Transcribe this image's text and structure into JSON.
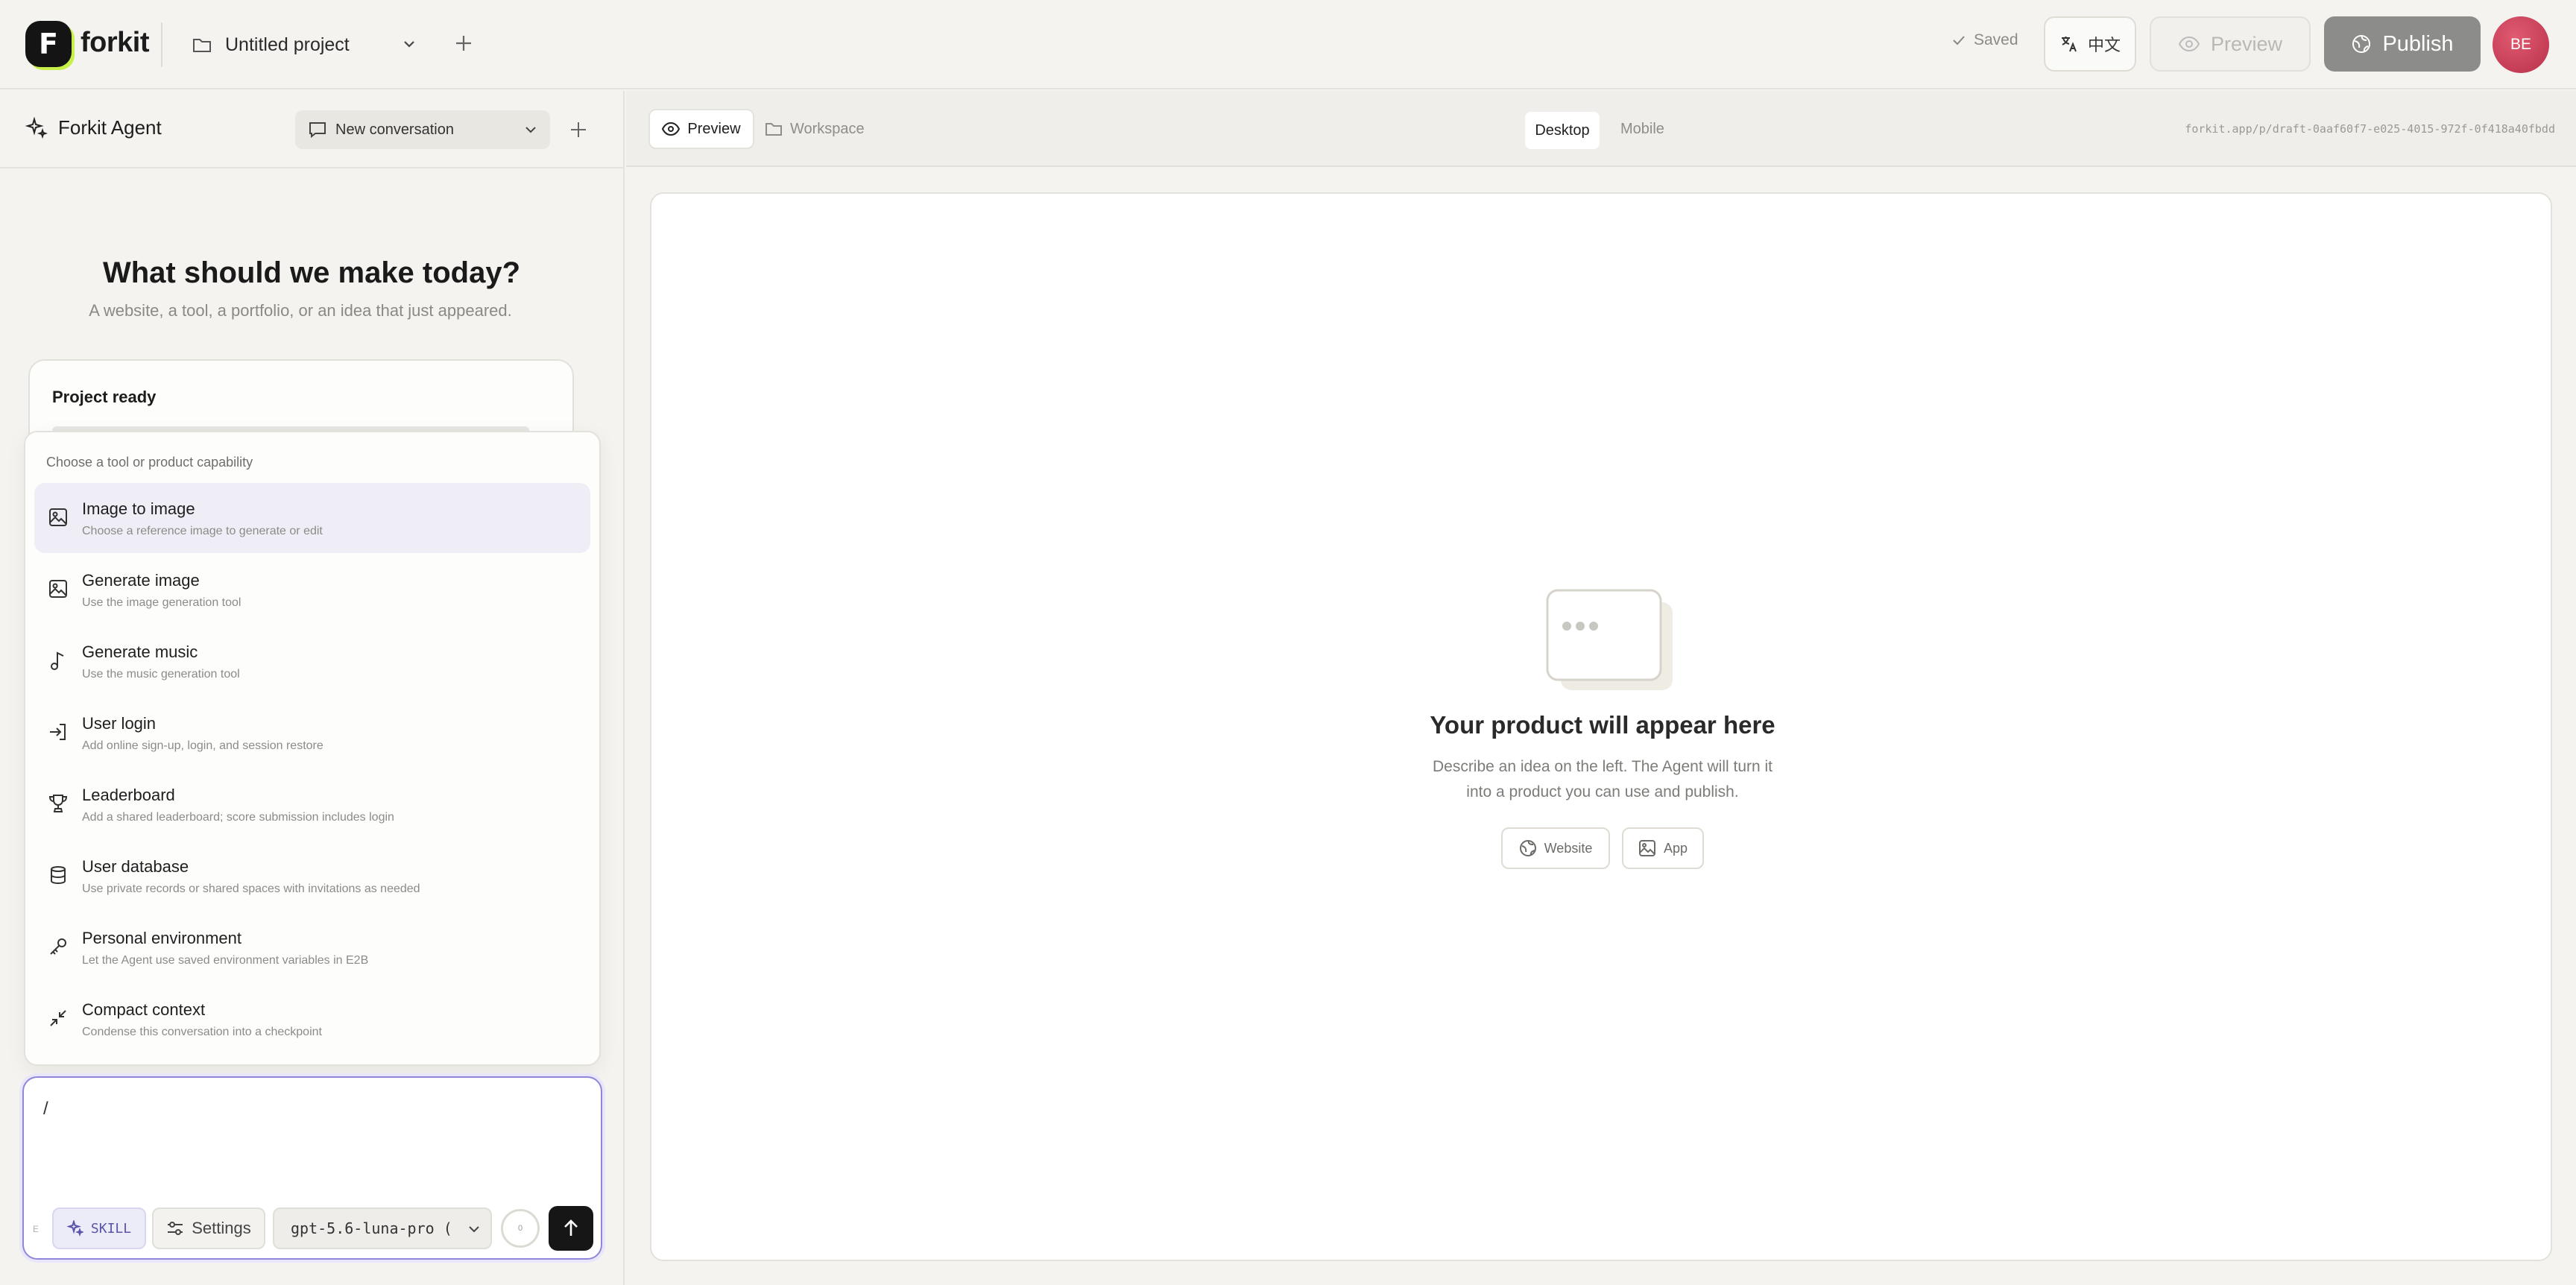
{
  "header": {
    "logo_letter": "F",
    "brand": "forkit",
    "project_name": "Untitled project",
    "saved_label": "Saved",
    "language_label": "中文",
    "preview_label": "Preview",
    "publish_label": "Publish",
    "avatar_initials": "BE"
  },
  "agent": {
    "title": "Forkit Agent",
    "conversation_label": "New conversation"
  },
  "hero": {
    "title": "What should we make today?",
    "subtitle": "A website, a tool, a portfolio, or an idea that just appeared."
  },
  "ready_card": {
    "title": "Project ready"
  },
  "tool_menu": {
    "heading": "Choose a tool or product capability",
    "items": [
      {
        "label": "Image to image",
        "desc": "Choose a reference image to generate or edit",
        "icon": "image-icon"
      },
      {
        "label": "Generate image",
        "desc": "Use the image generation tool",
        "icon": "image-icon"
      },
      {
        "label": "Generate music",
        "desc": "Use the music generation tool",
        "icon": "music-note-icon"
      },
      {
        "label": "User login",
        "desc": "Add online sign-up, login, and session restore",
        "icon": "login-icon"
      },
      {
        "label": "Leaderboard",
        "desc": "Add a shared leaderboard; score submission includes login",
        "icon": "trophy-icon"
      },
      {
        "label": "User database",
        "desc": "Use private records or shared spaces with invitations as needed",
        "icon": "database-icon"
      },
      {
        "label": "Personal environment",
        "desc": "Let the Agent use saved environment variables in E2B",
        "icon": "key-icon"
      },
      {
        "label": "Compact context",
        "desc": "Condense this conversation into a checkpoint",
        "icon": "compress-icon"
      }
    ]
  },
  "composer": {
    "value": "/",
    "edge_label": "E",
    "skill_label": "SKILL",
    "settings_label": "Settings",
    "model_label": "gpt-5.6-luna-pro (",
    "context_usage": "0"
  },
  "preview_bar": {
    "tab_preview": "Preview",
    "tab_workspace": "Workspace",
    "device_desktop": "Desktop",
    "device_mobile": "Mobile",
    "url": "forkit.app/p/draft-0aaf60f7-e025-4015-972f-0f418a40fbdd"
  },
  "empty_state": {
    "title": "Your product will appear here",
    "desc": "Describe an idea on the left. The Agent will turn it into a product you can use and publish.",
    "chip_website": "Website",
    "chip_app": "App"
  },
  "colors": {
    "accent": "#8e86d8",
    "logo_highlight": "#c8f04a",
    "publish_bg": "#8c8c8a",
    "avatar": "#c4405a"
  }
}
